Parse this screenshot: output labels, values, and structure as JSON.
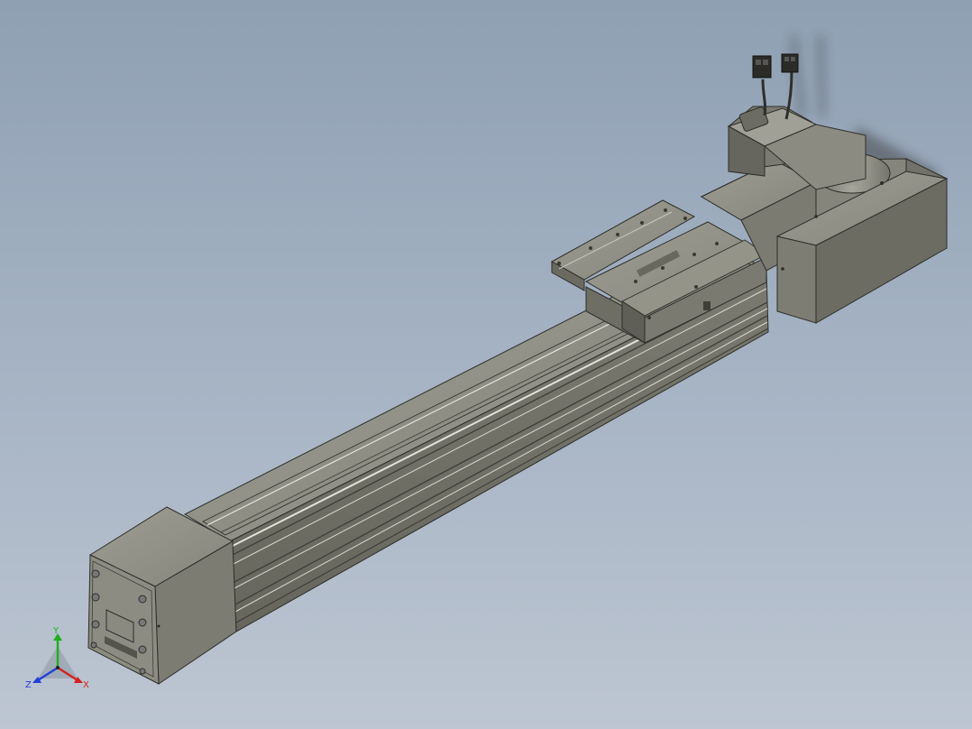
{
  "scene": {
    "background_top": "#8fa0b3",
    "background_bottom": "#bdc6d2",
    "model": "linear-actuator-with-servo-motor",
    "body_color": "#8a8a80",
    "edge_color": "#2e2e2a"
  },
  "triad": {
    "x_label": "X",
    "y_label": "Y",
    "z_label": "Z",
    "x_color": "#d42020",
    "y_color": "#1fae1f",
    "z_color": "#2040d8"
  }
}
